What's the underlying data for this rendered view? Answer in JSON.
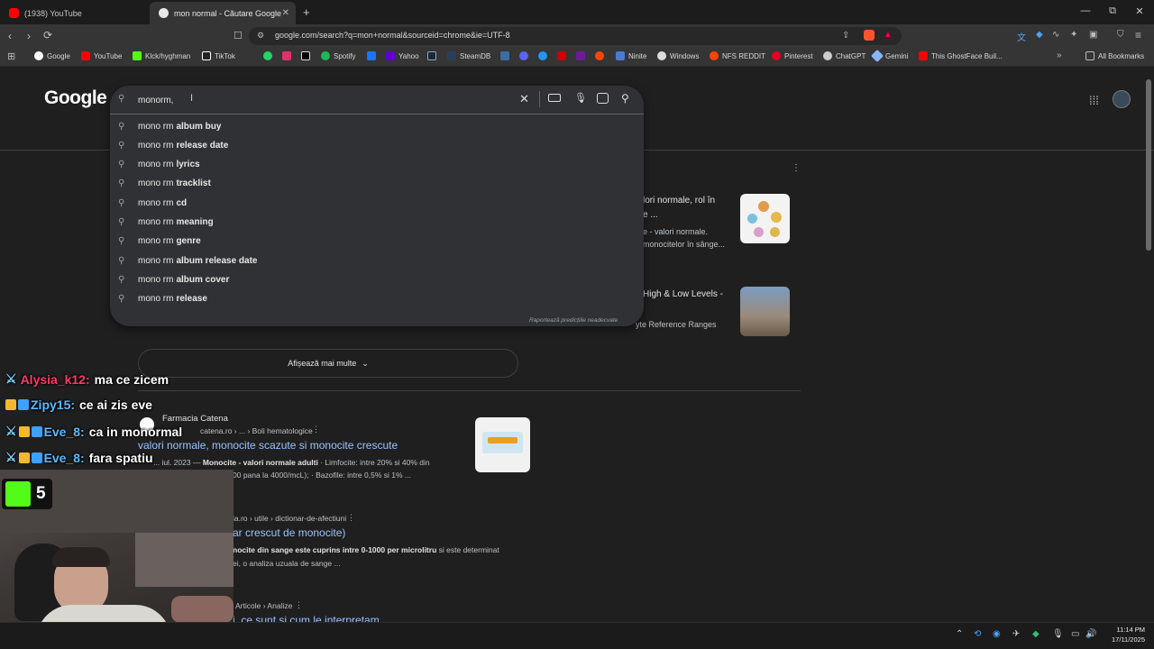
{
  "tabs": [
    {
      "title": "(1938) YouTube",
      "favicon_color": "#ff0000"
    },
    {
      "title": "mon normal - Căutare Google",
      "favicon_color": "#4285f4",
      "active": true
    }
  ],
  "new_tab_symbol": "+",
  "window_controls": {
    "minimize": "—",
    "maximize": "⧉",
    "close": "✕"
  },
  "toolbar": {
    "url": "google.com/search?q=mon+normal&sourceid=chrome&ie=UTF-8"
  },
  "bookmarks": [
    {
      "label": "Google",
      "color": "#4285f4"
    },
    {
      "label": "YouTube",
      "color": "#ff0000"
    },
    {
      "label": "Klck/hyghman",
      "color": "#53fc18"
    },
    {
      "label": "TikTok",
      "color": "#ffffff"
    },
    {
      "label": "Spotify",
      "color": "#1db954"
    },
    {
      "label": "Yahoo",
      "color": "#6001d2"
    },
    {
      "label": "SteamDB",
      "color": "#8ab4f8"
    },
    {
      "label": "Ninite",
      "color": "#8ab4f8"
    },
    {
      "label": "Windows",
      "color": "#ffffff"
    },
    {
      "label": "NFS REDDIT",
      "color": "#ff4500"
    },
    {
      "label": "Pinterest",
      "color": "#e60023"
    },
    {
      "label": "ChatGPT",
      "color": "#ffffff"
    },
    {
      "label": "Gemini",
      "color": "#8ab4f8"
    },
    {
      "label": "This GhostFace Buil...",
      "color": "#ff0000"
    }
  ],
  "all_bookmarks": "All Bookmarks",
  "logo": "Google",
  "search": {
    "value": "monorm,",
    "suggestions": [
      {
        "prefix": "mono rm",
        "bold": "album buy"
      },
      {
        "prefix": "mono rm",
        "bold": "release date"
      },
      {
        "prefix": "mono rm",
        "bold": "lyrics"
      },
      {
        "prefix": "mono rm",
        "bold": "tracklist"
      },
      {
        "prefix": "mono rm",
        "bold": "cd"
      },
      {
        "prefix": "mono rm",
        "bold": "meaning"
      },
      {
        "prefix": "mono rm",
        "bold": "genre"
      },
      {
        "prefix": "mono rm",
        "bold": "album release date"
      },
      {
        "prefix": "mono rm",
        "bold": "album cover"
      },
      {
        "prefix": "mono rm",
        "bold": "release"
      }
    ],
    "report": "Raportează predicțiile neadecvate"
  },
  "right_results": [
    {
      "title_l1": "lori normale, rol în",
      "title_l2": "e ...",
      "snip_l1": "e - valori normale.",
      "snip_l2": "monocitelor în sânge..."
    },
    {
      "title_l1": "High & Low Levels -",
      "snip_l1": "yte Reference Ranges"
    }
  ],
  "show_more": "Afișează mai multe",
  "results": [
    {
      "source": "Farmacia Catena",
      "breadcrumb": "catena.ro › ... › Boli hematologice",
      "title": "valori normale, monocite scazute si monocite crescute",
      "date": "... iul. 2023 —",
      "snippet_bold": "Monocite - valori normale adulti",
      "snippet_rest": "· Limfocite: intre 20% si 40% din",
      "snippet_l2": "00 pana la 4000/mcL); · Bazofile: intre 0,5% si 1% ..."
    },
    {
      "breadcrumb": "ia.ro › utile › dictionar-de-afectiuni",
      "title": "ar crescut de monocite)",
      "snippet_bold": "nocite din sange este cuprins intre 0-1000 per microlitru",
      "snippet_rest": "si este determinat",
      "snippet_l2": "ei, o analiza uzuala de sange ..."
    },
    {
      "breadcrumb": "Articole › Analize",
      "title": "i, ce sunt si cum le interpretam"
    }
  ],
  "chat": [
    {
      "user": "Alysia_k12:",
      "message": "ma ce zicem",
      "color": "#ff3b6b"
    },
    {
      "user": "Zipy15:",
      "message": "ce ai zis eve",
      "color": "#5db8ff"
    },
    {
      "user": "Eve_8:",
      "message": "ca in monormal",
      "color": "#5db8ff"
    },
    {
      "user": "Eve_8:",
      "message": "fara spatiu",
      "color": "#5db8ff"
    }
  ],
  "kick_count": "5",
  "clock": {
    "time": "11:14 PM",
    "date": "17/11/2025"
  }
}
